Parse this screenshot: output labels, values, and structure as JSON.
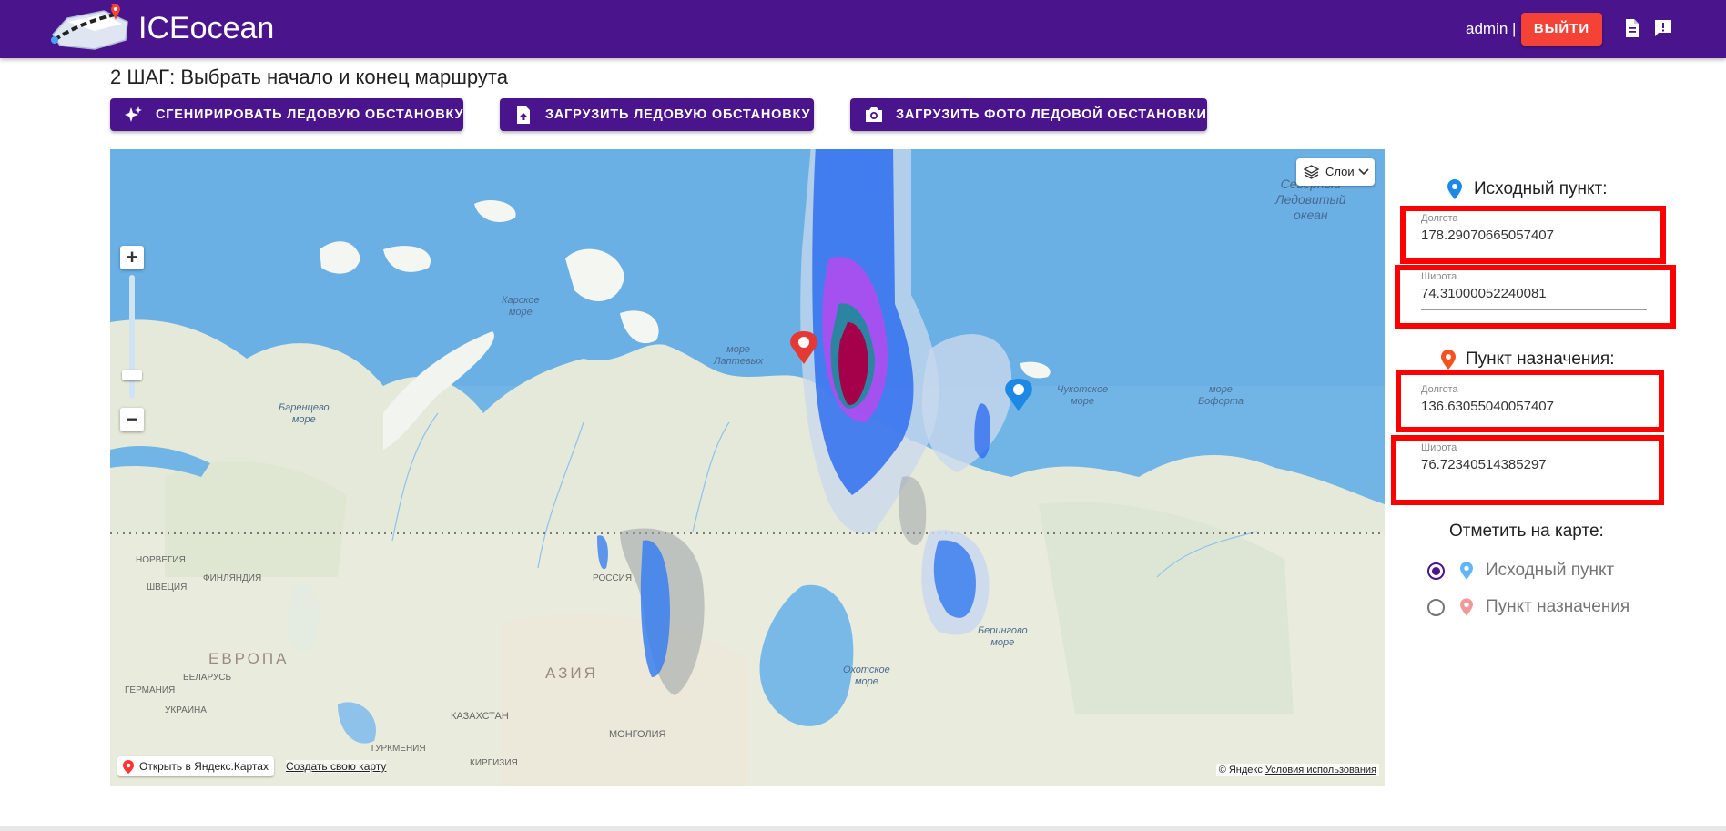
{
  "header": {
    "brand": "ICEocean",
    "user": "admin |",
    "logout_label": "ВЫЙТИ",
    "icons": [
      "document-icon",
      "feedback-icon"
    ],
    "color": "#4a148c"
  },
  "step": {
    "title": "2 ШАГ: Выбрать начало и конец маршрута"
  },
  "toolbar": {
    "generate_label": "СГЕНИРИРОВАТЬ ЛЕДОВУЮ ОБСТАНОВКУ",
    "upload_label": "ЗАГРУЗИТЬ ЛЕДОВУЮ ОБСТАНОВКУ",
    "photo_label": "ЗАГРУЗИТЬ ФОТО ЛЕДОВОЙ ОБСТАНОВКИ"
  },
  "map": {
    "layers_label": "Слои",
    "zoom_in": "+",
    "zoom_out": "−",
    "open_yandex": "Открыть в Яндекс.Картах",
    "create_map": "Создать свою карту",
    "copyright": "© Яндекс",
    "terms": "Условия использования",
    "labels": {
      "kara_sea": "Карское\nморе",
      "laptev_sea": "море\nЛаптевых",
      "barents_sea": "Баренцево\nморе",
      "chukchi_sea": "Чукотское\nморе",
      "beaufort_sea": "море\nБофорта",
      "arctic_ocean": "Северный\nЛедовитый\nокеан",
      "okhotsk_sea": "Охотское\nморе",
      "bering_sea": "Берингово\nморе",
      "europe": "ЕВРОПА",
      "asia": "АЗИЯ",
      "kazakhstan": "КАЗАХСТАН",
      "mongolia": "МОНГОЛИЯ",
      "norway": "НОРВЕГИЯ",
      "sweden": "ШВЕЦИЯ",
      "finland": "ФИНЛЯНДИЯ",
      "russia": "РОССИЯ",
      "belarus": "БЕЛАРУСЬ",
      "ukraine": "УКРАИНА",
      "germany": "ГЕРМАНИЯ",
      "kyrgyzstan": "КИРГИЗИЯ",
      "turkmenistan": "ТУРКМЕНИЯ"
    },
    "ice_colors": [
      "#c9d8ee",
      "#2f6ef0",
      "#b04cf0",
      "#1f8a9a",
      "#a5004a",
      "#9aa0a6"
    ]
  },
  "panel": {
    "source_title": "Исходный пункт:",
    "dest_title": "Пункт назначения:",
    "source_lon_label": "Долгота",
    "source_lon_value": "178.29070665057407",
    "source_lat_label": "Широта",
    "source_lat_value": "74.31000052240081",
    "dest_lon_label": "Долгота",
    "dest_lon_value": "136.63055040057407",
    "dest_lat_label": "Широта",
    "dest_lat_value": "76.72340514385297",
    "mark_title": "Отметить на карте:",
    "radio_source": "Исходный пункт",
    "radio_dest": "Пункт назначения",
    "selected": "source"
  }
}
